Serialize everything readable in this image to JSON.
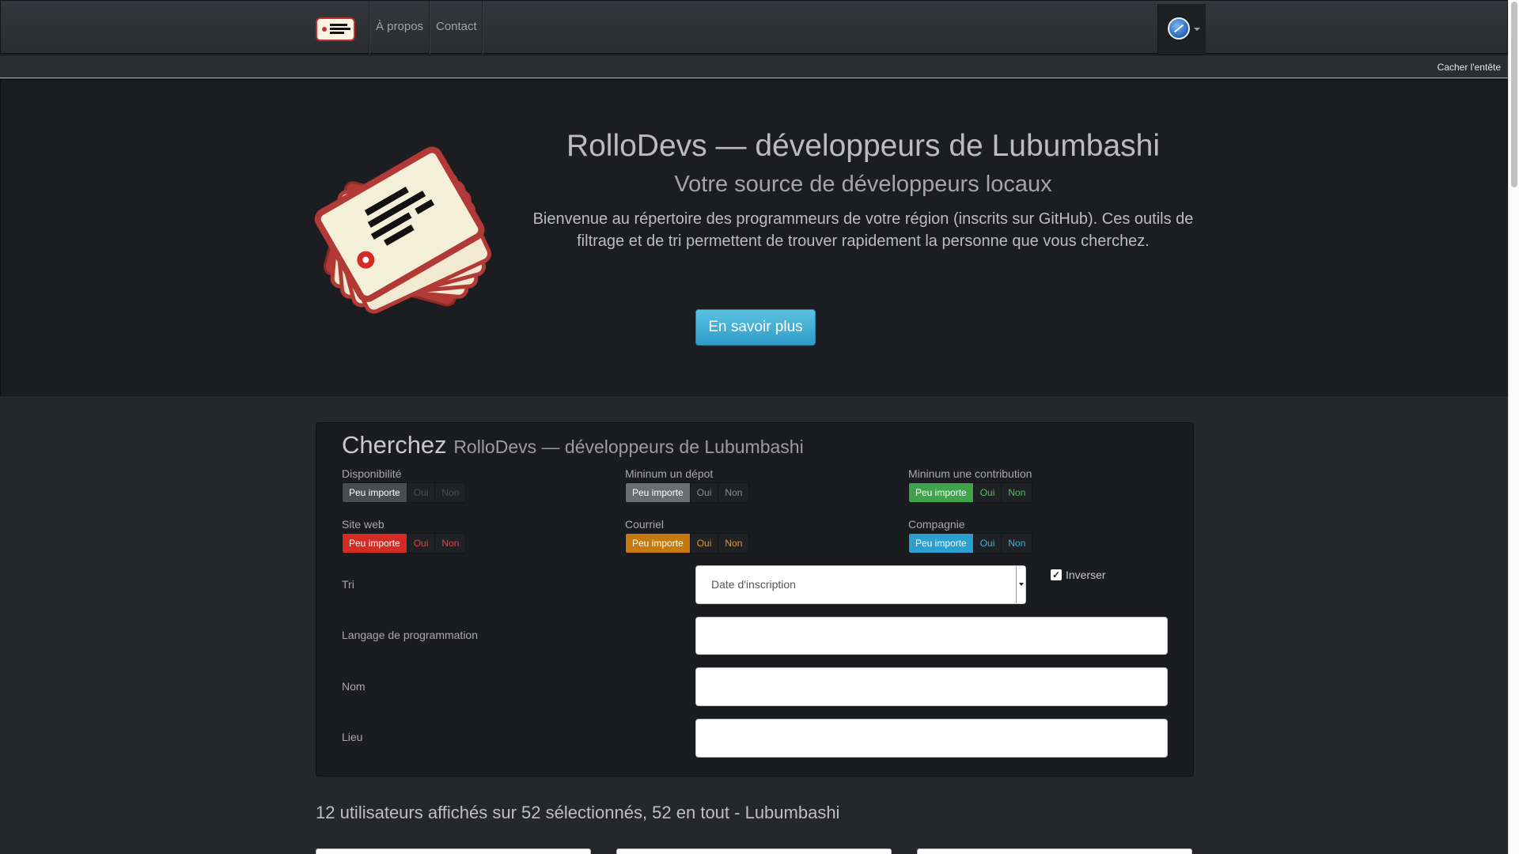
{
  "nav": {
    "links": [
      "À propos",
      "Contact"
    ],
    "hide_header": "Cacher l'entête"
  },
  "hero": {
    "title": "RolloDevs — développeurs de Lubumbashi",
    "subtitle": "Votre source de développeurs locaux",
    "lead": "Bienvenue au répertoire des programmeurs de votre région (inscrits sur GitHub). Ces outils de filtrage et de tri permettent de trouver rapidement la personne que vous cherchez.",
    "button": "En savoir plus"
  },
  "search": {
    "title": "Cherchez",
    "title_small": "RolloDevs — développeurs de Lubumbashi",
    "filters": [
      {
        "label": "Disponibilité",
        "options": [
          "Peu importe",
          "Oui",
          "Non"
        ],
        "color": "#4a4c50"
      },
      {
        "label": "Mininum un dépot",
        "options": [
          "Peu importe",
          "Oui",
          "Non"
        ],
        "color": "#6a6d72"
      },
      {
        "label": "Mininum une contribution",
        "options": [
          "Peu importe",
          "Oui",
          "Non"
        ],
        "color": "#3fa34d"
      },
      {
        "label": "Site web",
        "options": [
          "Peu importe",
          "Oui",
          "Non"
        ],
        "color": "#d42b25"
      },
      {
        "label": "Courriel",
        "options": [
          "Peu importe",
          "Oui",
          "Non"
        ],
        "color": "#c47a0e"
      },
      {
        "label": "Compagnie",
        "options": [
          "Peu importe",
          "Oui",
          "Non"
        ],
        "color": "#2b9fd0"
      }
    ],
    "sort_label": "Tri",
    "sort_value": "Date d'inscription",
    "invert_label": "Inverser",
    "invert_checked": true,
    "language_label": "Langage de programmation",
    "name_label": "Nom",
    "place_label": "Lieu"
  },
  "results": "12 utilisateurs affichés sur 52 sélectionnés, 52 en tout - Lubumbashi"
}
